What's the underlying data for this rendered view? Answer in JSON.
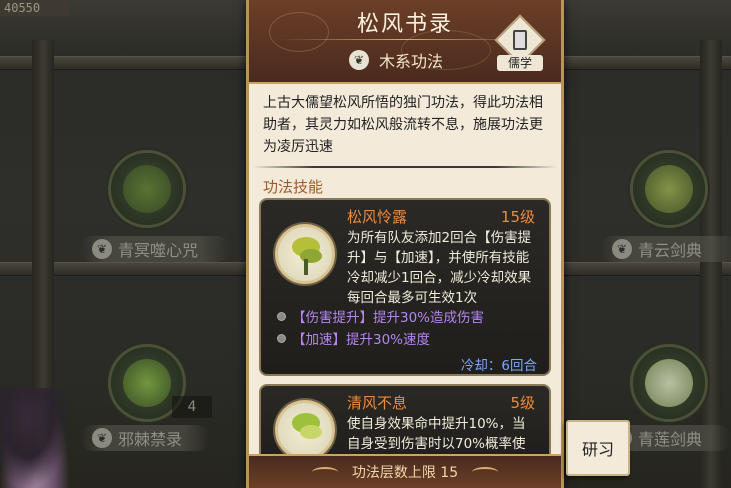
{
  "top_counter": "40550",
  "background_books": [
    {
      "name": "青冥噬心咒"
    },
    {
      "name": "青云剑典"
    },
    {
      "name": "邪棘禁录"
    },
    {
      "name": "青莲剑典"
    }
  ],
  "count_badge": "4",
  "panel": {
    "title": "松风书录",
    "element_label": "木系功法",
    "school_label": "儒学",
    "description": "上古大儒望松风所悟的独门功法，得此功法相助者，其灵力如松风般流转不息，施展功法更为凌厉迅速",
    "section_title": "功法技能",
    "skills": [
      {
        "name": "松风怜露",
        "level": "15级",
        "text": "为所有队友添加2回合【伤害提升】与【加速】，并使所有技能冷却减少1回合，减少冷却效果每回合最多可生效1次",
        "buffs": [
          {
            "label": "【伤害提升】提升30%造成伤害"
          },
          {
            "label": "【加速】提升30%速度"
          }
        ],
        "cooldown": "冷却：6回合"
      },
      {
        "name": "清风不息",
        "level": "5级",
        "text": "使自身效果命中提升10%，当自身受到伤害时以70%概率使"
      }
    ],
    "footer": "功法层数上限 15"
  },
  "research_button": "研习",
  "colors": {
    "accent_orange": "#f08a3a",
    "buff_purple": "#b486f2",
    "cooldown_blue": "#7aa8ff",
    "section_brown": "#9e5a28"
  }
}
